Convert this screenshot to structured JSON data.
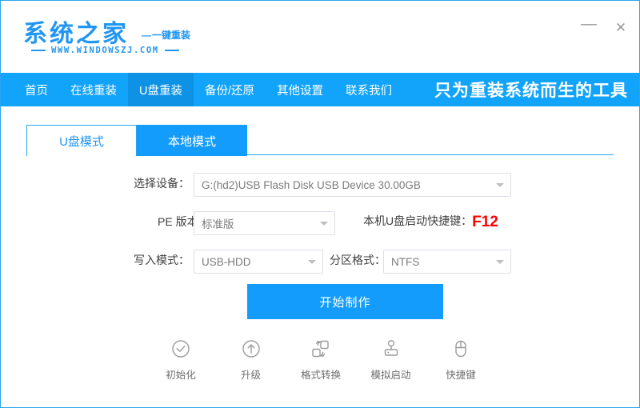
{
  "window": {
    "logo_main": "系统之家",
    "logo_sub": "一键重装",
    "logo_url": "WWW.WINDOWSZJ.COM",
    "minimize_label": "—",
    "close_label": "✕"
  },
  "nav": {
    "items": [
      {
        "label": "首页",
        "active": false
      },
      {
        "label": "在线重装",
        "active": false
      },
      {
        "label": "U盘重装",
        "active": true
      },
      {
        "label": "备份/还原",
        "active": false
      },
      {
        "label": "其他设置",
        "active": false
      },
      {
        "label": "联系我们",
        "active": false
      }
    ],
    "slogan": "只为重装系统而生的工具"
  },
  "tabs": [
    {
      "label": "U盘模式",
      "selected": true
    },
    {
      "label": "本地模式",
      "selected": false
    }
  ],
  "form": {
    "device_label": "选择设备：",
    "device_value": "G:(hd2)USB Flash Disk USB Device 30.00GB",
    "pe_label": "PE 版本：",
    "pe_value": "标准版",
    "shortcut_label": "本机U盘启动快捷键：",
    "shortcut_key": "F12",
    "write_mode_label": "写入模式：",
    "write_mode_value": "USB-HDD",
    "partition_label": "分区格式：",
    "partition_value": "NTFS"
  },
  "start_button": "开始制作",
  "tools": [
    {
      "label": "初始化",
      "icon": "check-circle-icon"
    },
    {
      "label": "升级",
      "icon": "arrow-up-circle-icon"
    },
    {
      "label": "格式转换",
      "icon": "convert-icon"
    },
    {
      "label": "模拟启动",
      "icon": "joystick-icon"
    },
    {
      "label": "快捷键",
      "icon": "mouse-icon"
    }
  ],
  "colors": {
    "brand_blue": "#12a3fb",
    "nav_active_blue": "#0d92e6",
    "button_blue": "#139cfb",
    "alert_red": "#ff0000",
    "border_gray": "#dcdfe6"
  }
}
